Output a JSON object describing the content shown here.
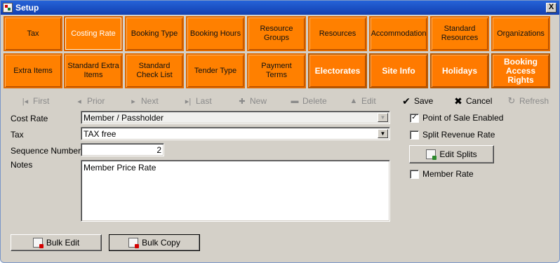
{
  "window": {
    "title": "Setup",
    "close_label": "X"
  },
  "tiles_row1": [
    {
      "label": "Tax"
    },
    {
      "label": "Costing Rate"
    },
    {
      "label": "Booking Type"
    },
    {
      "label": "Booking Hours"
    },
    {
      "label": "Resource Groups"
    },
    {
      "label": "Resources"
    },
    {
      "label": "Accommodation"
    },
    {
      "label": "Standard Resources"
    },
    {
      "label": "Organizations"
    }
  ],
  "tiles_row2": [
    {
      "label": "Extra Items"
    },
    {
      "label": "Standard Extra Items"
    },
    {
      "label": "Standard Check List"
    },
    {
      "label": "Tender Type"
    },
    {
      "label": "Payment Terms"
    },
    {
      "label": "Electorates"
    },
    {
      "label": "Site Info"
    },
    {
      "label": "Holidays"
    },
    {
      "label": "Booking Access Rights"
    }
  ],
  "toolbar": {
    "first": {
      "label": "First",
      "icon": "first-icon"
    },
    "prior": {
      "label": "Prior",
      "icon": "prior-icon"
    },
    "next": {
      "label": "Next",
      "icon": "next-icon"
    },
    "last": {
      "label": "Last",
      "icon": "last-icon"
    },
    "new": {
      "label": "New",
      "icon": "new-icon"
    },
    "delete": {
      "label": "Delete",
      "icon": "delete-icon"
    },
    "edit": {
      "label": "Edit",
      "icon": "edit-icon"
    },
    "save": {
      "label": "Save",
      "icon": "checkmark-icon"
    },
    "cancel": {
      "label": "Cancel",
      "icon": "cross-icon"
    },
    "refresh": {
      "label": "Refresh",
      "icon": "refresh-icon"
    }
  },
  "form": {
    "cost_rate_label": "Cost Rate",
    "cost_rate_value": "Member / Passholder",
    "tax_label": "Tax",
    "tax_value": "TAX free",
    "sequence_label": "Sequence Number",
    "sequence_value": "2",
    "notes_label": "Notes",
    "notes_value": "Member Price Rate"
  },
  "options": {
    "point_of_sale_label": "Point of Sale Enabled",
    "point_of_sale_checked": true,
    "split_revenue_label": "Split Revenue Rate",
    "split_revenue_checked": false,
    "edit_splits_label": "Edit Splits",
    "member_rate_label": "Member Rate",
    "member_rate_checked": false
  },
  "bottom": {
    "bulk_edit_label": "Bulk Edit",
    "bulk_copy_label": "Bulk Copy"
  },
  "colors": {
    "tile_orange": "#ff8000",
    "title_blue": "#2563d8",
    "window_grey": "#d4d0c8"
  }
}
